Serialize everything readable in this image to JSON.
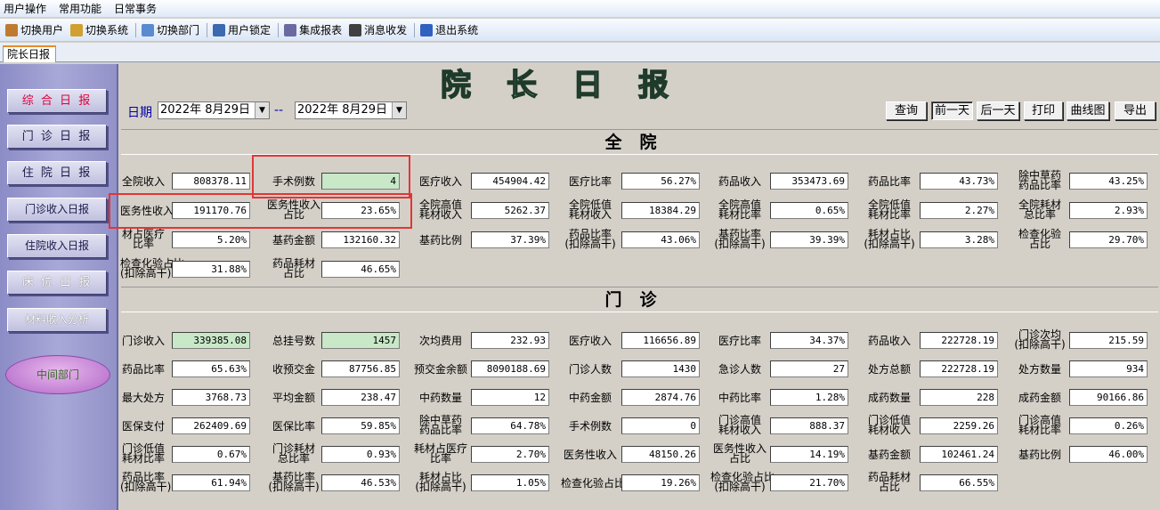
{
  "menu": [
    "用户操作",
    "常用功能",
    "日常事务"
  ],
  "toolbar": [
    {
      "label": "切换用户",
      "icon": "users-icon",
      "color": "#c07a30"
    },
    {
      "label": "切换系统",
      "icon": "switch-system-icon",
      "color": "#d0a030"
    },
    {
      "label": "切换部门",
      "icon": "department-icon",
      "color": "#5a8ad0"
    },
    {
      "label": "用户锁定",
      "icon": "user-lock-icon",
      "color": "#3a6ab0"
    },
    {
      "label": "集成报表",
      "icon": "report-icon",
      "color": "#6a6aa0"
    },
    {
      "label": "消息收发",
      "icon": "message-icon",
      "color": "#404040"
    },
    {
      "label": "退出系统",
      "icon": "exit-icon",
      "color": "#3060c0"
    }
  ],
  "tab": "院长日报",
  "nav": [
    "综 合 日 报",
    "门 诊 日 报",
    "住 院 日 报",
    "门诊收入日报",
    "住院收入日报",
    "床 位 日 报",
    "材料收入分析"
  ],
  "nav_oval": "中间部门",
  "title": "院长日报",
  "date": {
    "label": "日期",
    "from": "2022年 8月29日",
    "sep": "--",
    "to": "2022年 8月29日"
  },
  "buttons": [
    "查询",
    "前一天",
    "后一天",
    "打印",
    "曲线图",
    "导出"
  ],
  "sections": {
    "hospital": "全院",
    "outpatient": "门诊"
  },
  "hospital_fields": [
    [
      "全院收入",
      "808378.11"
    ],
    [
      "手术例数",
      "4"
    ],
    [
      "医疗收入",
      "454904.42"
    ],
    [
      "医疗比率",
      "56.27%"
    ],
    [
      "药品收入",
      "353473.69"
    ],
    [
      "药品比率",
      "43.73%"
    ],
    [
      "除中草药\n药品比率",
      "43.25%"
    ],
    [
      "医务性收入",
      "191170.76"
    ],
    [
      "医务性收入\n占比",
      "23.65%"
    ],
    [
      "全院高值\n耗材收入",
      "5262.37"
    ],
    [
      "全院低值\n耗材收入",
      "18384.29"
    ],
    [
      "全院高值\n耗材比率",
      "0.65%"
    ],
    [
      "全院低值\n耗材比率",
      "2.27%"
    ],
    [
      "全院耗材\n总比率",
      "2.93%"
    ],
    [
      "材占医疗\n比率",
      "5.20%"
    ],
    [
      "基药金额",
      "132160.32"
    ],
    [
      "基药比例",
      "37.39%"
    ],
    [
      "药品比率\n(扣除高干)",
      "43.06%"
    ],
    [
      "基药比率\n(扣除高干)",
      "39.39%"
    ],
    [
      "耗材占比\n(扣除高干)",
      "3.28%"
    ],
    [
      "检查化验\n占比",
      "29.70%"
    ],
    [
      "检查化验占比\n(扣除高干)",
      "31.88%"
    ],
    [
      "药品耗材\n占比",
      "46.65%"
    ]
  ],
  "outpatient_fields": [
    [
      "门诊收入",
      "339385.08"
    ],
    [
      "总挂号数",
      "1457"
    ],
    [
      "次均费用",
      "232.93"
    ],
    [
      "医疗收入",
      "116656.89"
    ],
    [
      "医疗比率",
      "34.37%"
    ],
    [
      "药品收入",
      "222728.19"
    ],
    [
      "门诊次均\n(扣除高干)",
      "215.59"
    ],
    [
      "药品比率",
      "65.63%"
    ],
    [
      "收预交金",
      "87756.85"
    ],
    [
      "预交金余额",
      "8090188.69"
    ],
    [
      "门诊人数",
      "1430"
    ],
    [
      "急诊人数",
      "27"
    ],
    [
      "处方总额",
      "222728.19"
    ],
    [
      "处方数量",
      "934"
    ],
    [
      "最大处方",
      "3768.73"
    ],
    [
      "平均金额",
      "238.47"
    ],
    [
      "中药数量",
      "12"
    ],
    [
      "中药金额",
      "2874.76"
    ],
    [
      "中药比率",
      "1.28%"
    ],
    [
      "成药数量",
      "228"
    ],
    [
      "成药金额",
      "90166.86"
    ],
    [
      "医保支付",
      "262409.69"
    ],
    [
      "医保比率",
      "59.85%"
    ],
    [
      "除中草药\n药品比率",
      "64.78%"
    ],
    [
      "手术例数",
      "0"
    ],
    [
      "门诊高值\n耗材收入",
      "888.37"
    ],
    [
      "门诊低值\n耗材收入",
      "2259.26"
    ],
    [
      "门诊高值\n耗材比率",
      "0.26%"
    ],
    [
      "门诊低值\n耗材比率",
      "0.67%"
    ],
    [
      "门诊耗材\n总比率",
      "0.93%"
    ],
    [
      "耗材占医疗\n比率",
      "2.70%"
    ],
    [
      "医务性收入",
      "48150.26"
    ],
    [
      "医务性收入\n占比",
      "14.19%"
    ],
    [
      "基药金额",
      "102461.24"
    ],
    [
      "基药比例",
      "46.00%"
    ],
    [
      "药品比率\n(扣除高干)",
      "61.94%"
    ],
    [
      "基药比率\n(扣除高干)",
      "46.53%"
    ],
    [
      "耗材占比\n(扣除高干)",
      "1.05%"
    ],
    [
      "检查化验占比",
      "19.26%"
    ],
    [
      "检查化验占比\n(扣除高干)",
      "21.70%"
    ],
    [
      "药品耗材\n占比",
      "66.55%"
    ]
  ],
  "highlight_green": {
    "hospital": [
      1
    ],
    "outpatient": [
      0,
      1
    ]
  },
  "highlight_color": "#e23636"
}
